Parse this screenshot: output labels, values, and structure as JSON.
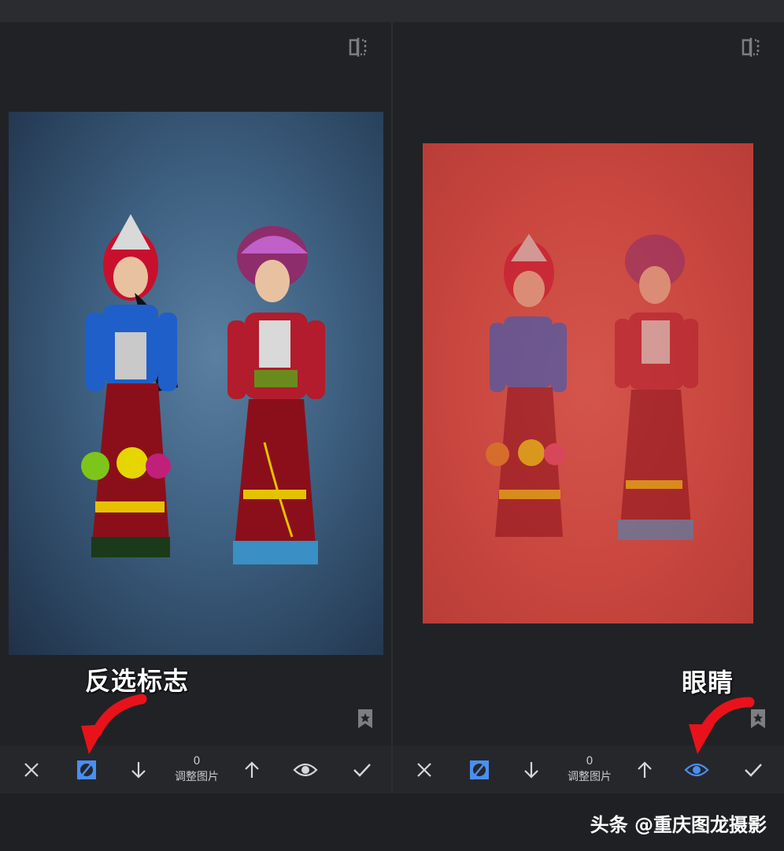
{
  "left_panel": {
    "counter_value": "0",
    "counter_label": "调整图片",
    "photo_subject": "two-dolls-blue-backdrop"
  },
  "right_panel": {
    "counter_value": "0",
    "counter_label": "调整图片",
    "photo_subject": "two-dolls-red-mask-overlay"
  },
  "annotations": {
    "invert_selection": "反选标志",
    "eye": "眼睛"
  },
  "toolbar_icons": [
    "close-icon",
    "invert-mask-icon",
    "down-arrow-icon",
    "counter",
    "up-arrow-icon",
    "eye-icon",
    "check-icon"
  ],
  "colors": {
    "accent_blue": "#4a8ff0",
    "mask_red": "#c9473f",
    "annotation_arrow": "#e8121b"
  },
  "footer": {
    "watermark": "头条 @重庆图龙摄影"
  }
}
